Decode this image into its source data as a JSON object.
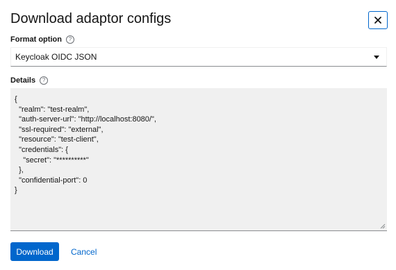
{
  "modal": {
    "title": "Download adaptor configs",
    "close_icon": "close-icon"
  },
  "format": {
    "label": "Format option",
    "help_icon": "help-icon",
    "selected": "Keycloak OIDC JSON"
  },
  "details": {
    "label": "Details",
    "help_icon": "help-icon",
    "content": "{\n  \"realm\": \"test-realm\",\n  \"auth-server-url\": \"http://localhost:8080/\",\n  \"ssl-required\": \"external\",\n  \"resource\": \"test-client\",\n  \"credentials\": {\n    \"secret\": \"**********\"\n  },\n  \"confidential-port\": 0\n}"
  },
  "actions": {
    "download_label": "Download",
    "cancel_label": "Cancel"
  },
  "colors": {
    "accent": "#0066cc",
    "text_area_bg": "#f0f0f0"
  }
}
